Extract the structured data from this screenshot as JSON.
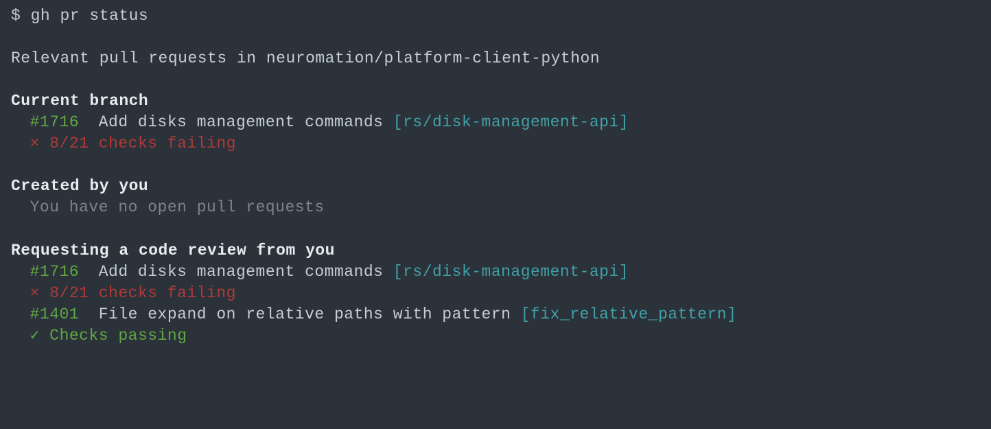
{
  "prompt": "$ gh pr status",
  "summary": "Relevant pull requests in neuromation/platform-client-python",
  "sections": {
    "current_branch": {
      "header": "Current branch",
      "items": [
        {
          "number": "#1716",
          "title": "Add disks management commands",
          "branch": "[rs/disk-management-api]",
          "status_icon": "×",
          "status_text": "8/21 checks failing",
          "status_type": "fail"
        }
      ]
    },
    "created_by_you": {
      "header": "Created by you",
      "empty_text": "You have no open pull requests"
    },
    "requesting_review": {
      "header": "Requesting a code review from you",
      "items": [
        {
          "number": "#1716",
          "title": "Add disks management commands",
          "branch": "[rs/disk-management-api]",
          "status_icon": "×",
          "status_text": "8/21 checks failing",
          "status_type": "fail"
        },
        {
          "number": "#1401",
          "title": "File expand on relative paths with pattern",
          "branch": "[fix_relative_pattern]",
          "status_icon": "✓",
          "status_text": "Checks passing",
          "status_type": "pass"
        }
      ]
    }
  }
}
